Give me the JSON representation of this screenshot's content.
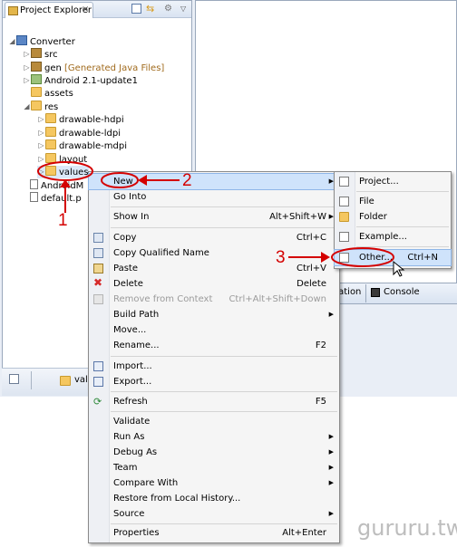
{
  "explorer": {
    "title": "Project Explorer",
    "close": "×",
    "tree": [
      {
        "text": "Converter",
        "extra": ""
      },
      {
        "text": "src",
        "extra": ""
      },
      {
        "text": "gen",
        "extra": "[Generated Java Files]"
      },
      {
        "text": "Android 2.1-update1",
        "extra": ""
      },
      {
        "text": "assets",
        "extra": ""
      },
      {
        "text": "res",
        "extra": ""
      },
      {
        "text": "drawable-hdpi",
        "extra": ""
      },
      {
        "text": "drawable-ldpi",
        "extra": ""
      },
      {
        "text": "drawable-mdpi",
        "extra": ""
      },
      {
        "text": "layout",
        "extra": ""
      },
      {
        "text": "values",
        "extra": ""
      },
      {
        "text": "AndroidM",
        "extra": ""
      },
      {
        "text": "default.p",
        "extra": ""
      }
    ],
    "bottom_label": "valu"
  },
  "console": {
    "tab_partial": "ration",
    "tab_console": "Console"
  },
  "context_menu": {
    "items": [
      {
        "label": "New",
        "accel": "",
        "submenu": true
      },
      {
        "label": "Go Into",
        "accel": ""
      },
      {
        "label": "Show In",
        "accel": "Alt+Shift+W",
        "submenu": true
      },
      {
        "label": "Copy",
        "accel": "Ctrl+C"
      },
      {
        "label": "Copy Qualified Name",
        "accel": ""
      },
      {
        "label": "Paste",
        "accel": "Ctrl+V"
      },
      {
        "label": "Delete",
        "accel": "Delete"
      },
      {
        "label": "Remove from Context",
        "accel": "Ctrl+Alt+Shift+Down"
      },
      {
        "label": "Build Path",
        "accel": "",
        "submenu": true
      },
      {
        "label": "Move...",
        "accel": ""
      },
      {
        "label": "Rename...",
        "accel": "F2"
      },
      {
        "label": "Import...",
        "accel": ""
      },
      {
        "label": "Export...",
        "accel": ""
      },
      {
        "label": "Refresh",
        "accel": "F5"
      },
      {
        "label": "Validate",
        "accel": ""
      },
      {
        "label": "Run As",
        "accel": "",
        "submenu": true
      },
      {
        "label": "Debug As",
        "accel": "",
        "submenu": true
      },
      {
        "label": "Team",
        "accel": "",
        "submenu": true
      },
      {
        "label": "Compare With",
        "accel": "",
        "submenu": true
      },
      {
        "label": "Restore from Local History...",
        "accel": ""
      },
      {
        "label": "Source",
        "accel": "",
        "submenu": true
      },
      {
        "label": "Properties",
        "accel": "Alt+Enter"
      }
    ],
    "submenu_arrow": "▶"
  },
  "new_submenu": {
    "items": [
      {
        "label": "Project...",
        "accel": ""
      },
      {
        "label": "File",
        "accel": ""
      },
      {
        "label": "Folder",
        "accel": ""
      },
      {
        "label": "Example...",
        "accel": ""
      },
      {
        "label": "Other...",
        "accel": "Ctrl+N"
      }
    ]
  },
  "annotations": {
    "step1": "1",
    "step2": "2",
    "step3": "3"
  },
  "watermark": "gururu.tw",
  "colors": {
    "annotation": "#d40000",
    "highlight": "#cfe3fb",
    "delete_icon": "#d62a2a"
  }
}
